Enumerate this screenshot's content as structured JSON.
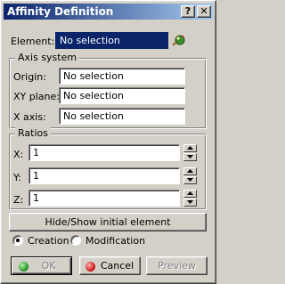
{
  "window": {
    "title": "Affinity Definition",
    "help_glyph": "?",
    "close_glyph": "✕"
  },
  "element": {
    "label": "Element:",
    "value": "No selection"
  },
  "axis_system": {
    "title": "Axis system",
    "origin_label": "Origin:",
    "origin_value": "No selection",
    "xy_plane_label": "XY plane:",
    "xy_plane_value": "No selection",
    "x_axis_label": "X axis:",
    "x_axis_value": "No selection"
  },
  "ratios": {
    "title": "Ratios",
    "x_label": "X:",
    "x_value": "1",
    "y_label": "Y:",
    "y_value": "1",
    "z_label": "Z:",
    "z_value": "1"
  },
  "hide_show_label": "Hide/Show initial element",
  "mode": {
    "creation_label": "Creation",
    "modification_label": "Modification",
    "selected": "Creation"
  },
  "buttons": {
    "ok_label": "OK",
    "cancel_label": "Cancel",
    "preview_label": "Preview"
  },
  "colors": {
    "title_bar_start": "#0a246a",
    "title_bar_end": "#a6caf0",
    "ok_dot": "#2ca02c",
    "cancel_dot": "#d62020"
  },
  "icons": {
    "element_selector": "selection-agent-icon",
    "ok": "green-dot-icon",
    "cancel": "red-dot-icon"
  }
}
